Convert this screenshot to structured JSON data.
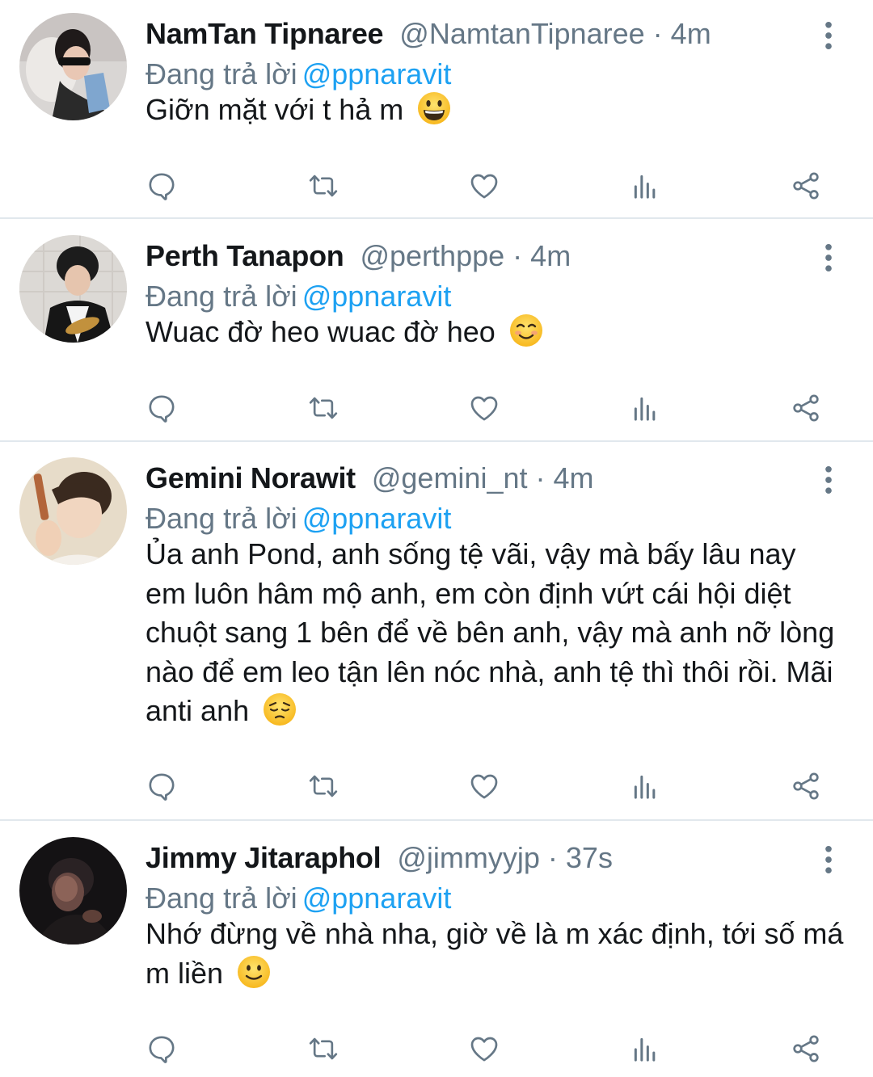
{
  "colors": {
    "accent": "#1da1f2",
    "secondary_text": "#657786",
    "primary_text": "#14171a",
    "divider": "#e1e8ed"
  },
  "tweets": [
    {
      "display_name": "NamTan Tipnaree",
      "handle": "@NamtanTipnaree",
      "separator": "·",
      "time": "4m",
      "replying_prefix": "Đang trả lời",
      "replying_to": "@ppnaravit",
      "text": "Giỡn mặt với t hả m",
      "emoji": "grinning-face"
    },
    {
      "display_name": "Perth Tanapon",
      "handle": "@perthppe",
      "separator": "·",
      "time": "4m",
      "replying_prefix": "Đang trả lời",
      "replying_to": "@ppnaravit",
      "text": "Wuac đờ heo wuac đờ heo",
      "emoji": "smiling-face-blush"
    },
    {
      "display_name": "Gemini Norawit",
      "handle": "@gemini_nt",
      "separator": "·",
      "time": "4m",
      "replying_prefix": "Đang trả lời",
      "replying_to": "@ppnaravit",
      "text": "Ủa anh Pond, anh sống tệ vãi, vậy mà bấy lâu nay em luôn hâm mộ anh, em còn định vứt cái hội diệt chuột sang 1 bên để về bên anh, vậy mà anh nỡ lòng nào để em leo tận lên nóc nhà, anh tệ thì thôi rồi. Mãi anti anh",
      "emoji": "pensive-face"
    },
    {
      "display_name": "Jimmy Jitaraphol",
      "handle": "@jimmyyjp",
      "separator": "·",
      "time": "37s",
      "replying_prefix": "Đang trả lời",
      "replying_to": "@ppnaravit",
      "text": "Nhớ đừng về nhà nha, giờ về là m xác định, tới số má m liền",
      "emoji": "slightly-smiling-face"
    }
  ],
  "action_icons": [
    "reply-icon",
    "retweet-icon",
    "like-icon",
    "analytics-icon",
    "share-icon"
  ]
}
